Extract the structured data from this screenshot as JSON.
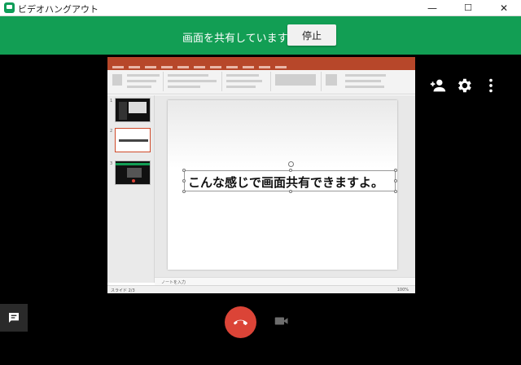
{
  "window": {
    "title": "ビデオハングアウト",
    "controls": {
      "minimize": "—",
      "maximize": "☐",
      "close": "✕"
    }
  },
  "share_bar": {
    "message": "画面を共有しています",
    "stop_label": "停止"
  },
  "shared_screen": {
    "app": "PowerPoint",
    "slide_text": "こんな感じで画面共有できますよ。",
    "thumbnail_numbers": [
      "1",
      "2",
      "3"
    ],
    "notes_placeholder": "ノートを入力",
    "status_left": "スライド 2/3",
    "zoom": "100%"
  },
  "actions": {
    "add_person_icon": "person-add-icon",
    "settings_icon": "gear-icon",
    "more_icon": "more-vert-icon",
    "chat_icon": "chat-icon",
    "hangup_icon": "hangup-icon",
    "camera_icon": "videocam-icon"
  },
  "colors": {
    "accent_green": "#129e54",
    "hangup_red": "#db4437",
    "ppt_red": "#b7472a"
  }
}
